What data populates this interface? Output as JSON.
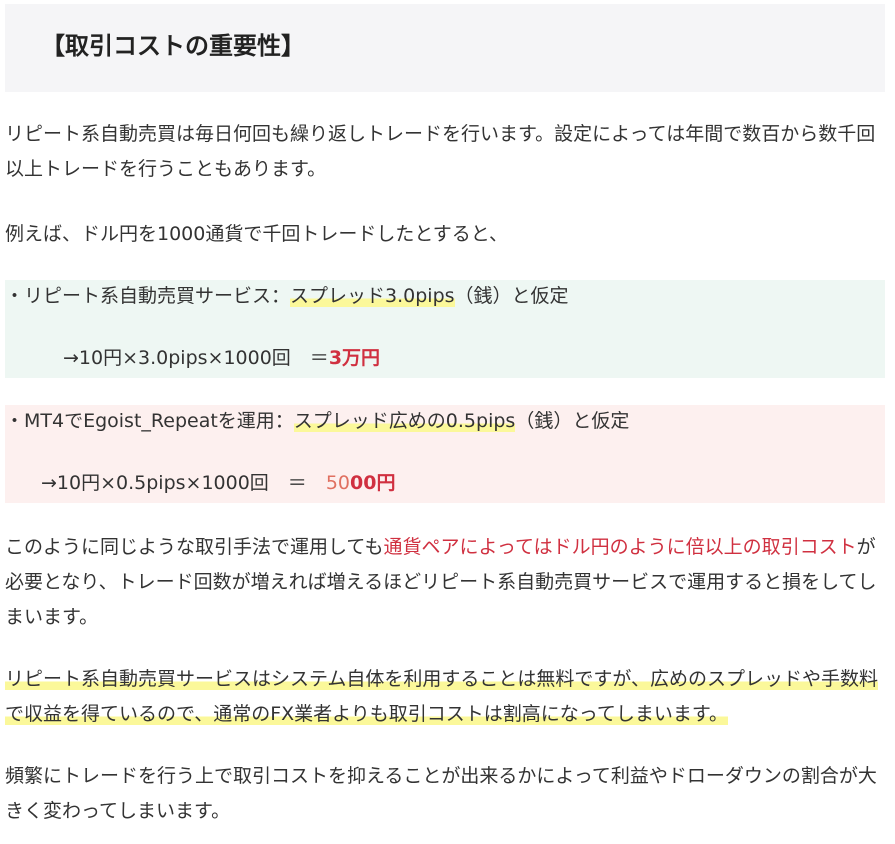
{
  "heading": "【取引コストの重要性】",
  "p1": "リピート系自動売買は毎日何回も繰り返しトレードを行います。設定によっては年間で数百から数千回以上トレードを行うこともあります。",
  "p2": "例えば、ドル円を1000通貨で千回トレードしたとすると、",
  "box1": {
    "prefix": "・リピート系自動売買サービス：",
    "highlight": "スプレッド3.0pips",
    "suffix": "（銭）と仮定",
    "calc": "→10円×3.0pips×1000回　＝",
    "result": "3万円"
  },
  "box2": {
    "prefix": "・MT4でEgoist_Repeatを運用：",
    "highlight": "スプレッド広めの0.5pips",
    "suffix": "（銭）と仮定",
    "calc": "→10円×0.5pips×1000回　＝　",
    "result_a": "50",
    "result_b": "00円"
  },
  "p3": {
    "a": "このように同じような取引手法で運用しても",
    "red": "通貨ペアによってはドル円のように倍以上の取引コスト",
    "b": "が必要となり、トレード回数が増えれば増えるほどリピート系自動売買サービスで運用すると損をしてしまいます。"
  },
  "p4": "リピート系自動売買サービスはシステム自体を利用することは無料ですが、広めのスプレッドや手数料で収益を得ているので、通常のFX業者よりも取引コストは割高になってしまいます。",
  "p5": "頻繁にトレードを行う上で取引コストを抑えることが出来るかによって利益やドローダウンの割合が大きく変わってしまいます。"
}
